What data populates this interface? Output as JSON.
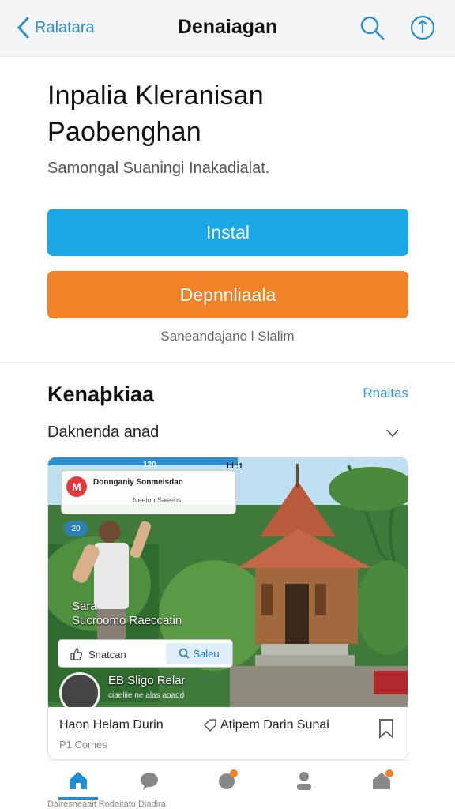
{
  "topbar": {
    "back_label": "Ralatara",
    "title": "Denaiagan"
  },
  "app": {
    "title_line1": "Inpalia Kleranisan",
    "title_line2": "Paobenghan",
    "subtitle": "Samongal Suaningi Inakadialat.",
    "install_label": "Instal",
    "download_label": "Depnnliaala",
    "footnote": "Saneandajano l Slalim"
  },
  "section": {
    "title": "Kenaþkiaa",
    "link": "Rnaltas",
    "dropdown": "Daknenda anad"
  },
  "preview": {
    "status_time": "120",
    "status_right": "l:l :1",
    "notif_title": "Donnganiy Sonmeisdan",
    "notif_sub": "Neeion Saeehs",
    "badge": "20",
    "overlay_line1": "Sara",
    "overlay_line2": "Sucroomo Raeccatin",
    "like_label": "Snatcan",
    "search_label": "Saleu",
    "store_name": "EB Sligo Relar",
    "store_sub": "ciaeliie ne alas aoadd",
    "bottom_left": "Haon Helam Durin",
    "bottom_left_sub": "P1 Comes",
    "bottom_mid": "Atipem Darin Sunai"
  },
  "bottom_nav": {
    "peek_text": "Dairesneaait   Rodaitatu   Diadira"
  },
  "colors": {
    "accent_blue": "#1aa7e6",
    "accent_orange": "#f08228",
    "link_blue": "#2a9cc8"
  }
}
